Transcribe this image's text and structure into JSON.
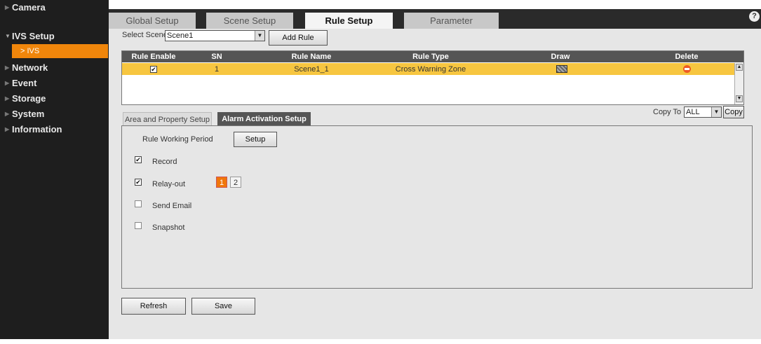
{
  "sidebar": {
    "items": [
      {
        "label": "Camera"
      },
      {
        "label": "IVS Setup"
      },
      {
        "label": "IVS"
      },
      {
        "label": "Network"
      },
      {
        "label": "Event"
      },
      {
        "label": "Storage"
      },
      {
        "label": "System"
      },
      {
        "label": "Information"
      }
    ]
  },
  "tabs": [
    {
      "label": "Global Setup"
    },
    {
      "label": "Scene Setup"
    },
    {
      "label": "Rule Setup"
    },
    {
      "label": "Parameter"
    }
  ],
  "help_icon": "?",
  "scene": {
    "label": "Select Scene",
    "value": "Scene1",
    "add_rule_label": "Add Rule"
  },
  "rule_table": {
    "headers": [
      "Rule Enable",
      "SN",
      "Rule Name",
      "Rule Type",
      "Draw",
      "Delete"
    ],
    "rows": [
      {
        "enabled": true,
        "sn": "1",
        "name": "Scene1_1",
        "type": "Cross Warning Zone"
      }
    ],
    "header_color": "#555555",
    "row_color": "#f7c640"
  },
  "subtabs": [
    {
      "label": "Area and Property Setup"
    },
    {
      "label": "Alarm Activation Setup"
    }
  ],
  "copy": {
    "label": "Copy To",
    "value": "ALL",
    "button_label": "Copy"
  },
  "alarm": {
    "working_period_label": "Rule Working Period",
    "setup_label": "Setup",
    "options": [
      {
        "label": "Record",
        "checked": true
      },
      {
        "label": "Relay-out",
        "checked": true
      },
      {
        "label": "Send Email",
        "checked": false
      },
      {
        "label": "Snapshot",
        "checked": false
      }
    ],
    "relays": [
      {
        "label": "1",
        "active": true
      },
      {
        "label": "2",
        "active": false
      }
    ]
  },
  "footer": {
    "refresh_label": "Refresh",
    "save_label": "Save"
  },
  "colors": {
    "accent": "#f0860b",
    "sidebar_bg": "#1e1e1e",
    "panel_bg": "#e6e6e6"
  }
}
